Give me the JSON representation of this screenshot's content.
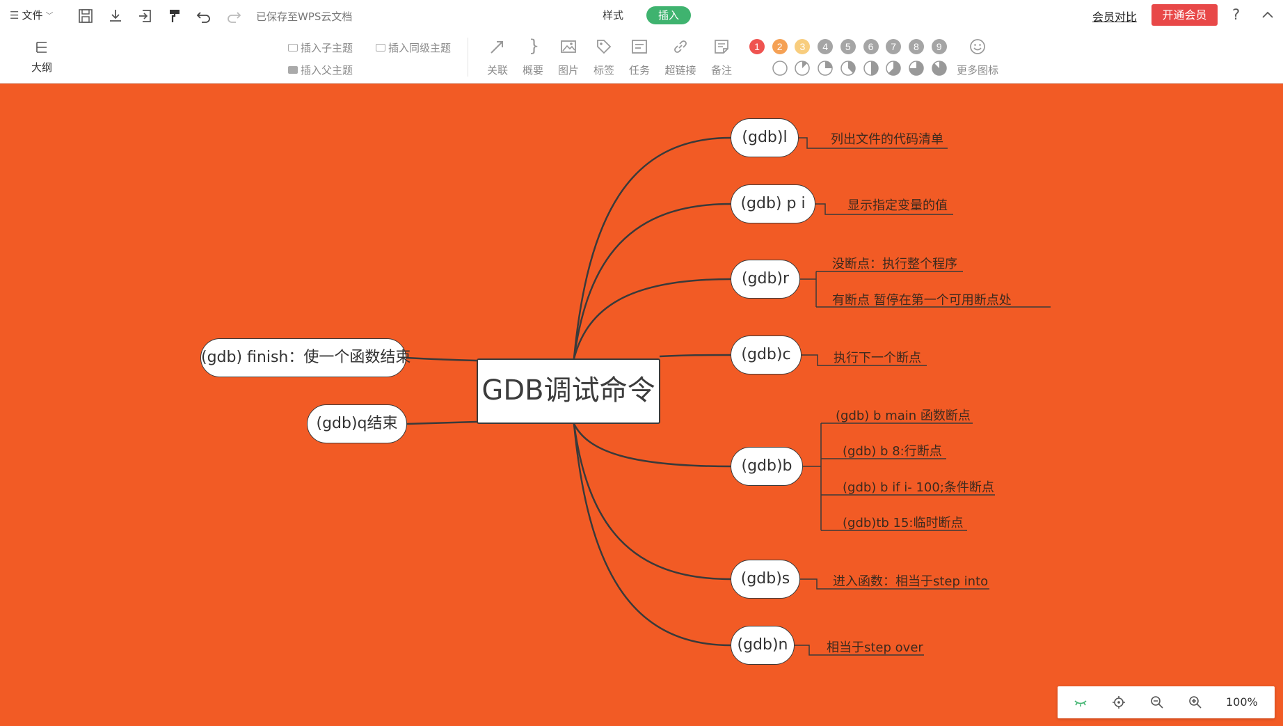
{
  "topbar": {
    "menu_label": "文件",
    "save_status": "已保存至WPS云文档",
    "tab_style": "样式",
    "tab_insert": "插入",
    "member_compare": "会员对比",
    "open_vip": "开通会员",
    "help": "?"
  },
  "toolbar": {
    "outline": "大纲",
    "insert_child": "插入子主题",
    "insert_sibling": "插入同级主题",
    "insert_parent": "插入父主题",
    "relation": "关联",
    "summary": "概要",
    "image": "图片",
    "tag": "标签",
    "task": "任务",
    "hyperlink": "超链接",
    "note": "备注",
    "more_icons": "更多图标",
    "priority_numbers": [
      "1",
      "2",
      "3",
      "4",
      "5",
      "6",
      "7",
      "8",
      "9"
    ],
    "priority_colors": [
      "#ef5350",
      "#f5a155",
      "#f8cd7e",
      "#a5a5a5",
      "#a5a5a5",
      "#a5a5a5",
      "#a5a5a5",
      "#a5a5a5",
      "#a5a5a5"
    ],
    "progress_fractions": [
      0,
      0.125,
      0.25,
      0.375,
      0.5,
      0.625,
      0.75,
      0.875,
      1
    ]
  },
  "mindmap": {
    "root": "GDB调试命令",
    "right_topics": [
      {
        "label": "(gdb)l",
        "notes": [
          "列出文件的代码清单"
        ]
      },
      {
        "label": "(gdb) p i",
        "notes": [
          "显示指定变量的值"
        ]
      },
      {
        "label": "(gdb)r",
        "notes": [
          "没断点：执行整个程序",
          "有断点       暂停在第一个可用断点处"
        ]
      },
      {
        "label": "(gdb)c",
        "notes": [
          "执行下一个断点"
        ]
      },
      {
        "label": "(gdb)b",
        "notes": [
          "(gdb) b main 函数断点",
          "(gdb) b 8:行断点",
          "(gdb) b if i- 100;条件断点",
          "(gdb)tb 15:临时断点"
        ]
      },
      {
        "label": "(gdb)s",
        "notes": [
          "进入函数：相当于step into"
        ]
      },
      {
        "label": "(gdb)n",
        "notes": [
          "相当于step over"
        ]
      }
    ],
    "left_topics": [
      {
        "label": "(gdb) finish：使一个函数结束"
      },
      {
        "label": "(gdb)q结束"
      }
    ]
  },
  "zoom": {
    "level": "100%"
  },
  "colors": {
    "canvas_bg": "#f25b25",
    "insert_green": "#3fb36f",
    "vip_red": "#e84848",
    "line": "#3a3a3a"
  }
}
